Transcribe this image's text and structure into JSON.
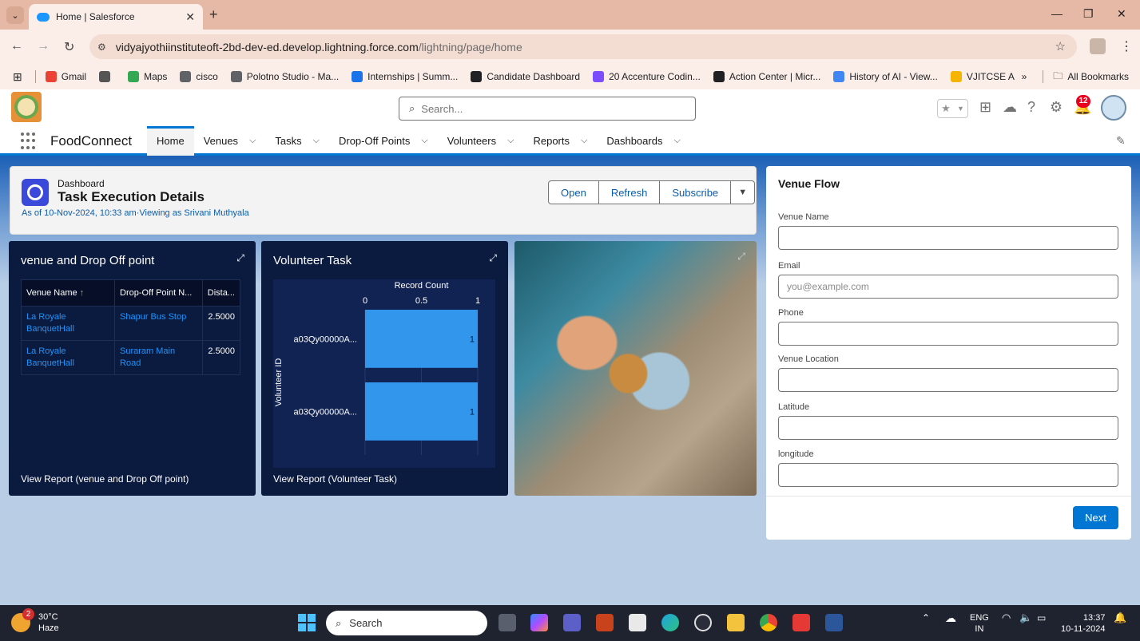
{
  "browser": {
    "tab_title": "Home | Salesforce",
    "url_main": "vidyajyothiinstituteoft-2bd-dev-ed.develop.lightning.force.com",
    "url_path": "/lightning/page/home",
    "bookmarks": [
      {
        "label": "Gmail",
        "icon": "gmail-icon",
        "color": "#ea4335"
      },
      {
        "label": "",
        "icon": "puzzle-icon",
        "color": "#555555"
      },
      {
        "label": "Maps",
        "icon": "maps-icon",
        "color": "#34a853"
      },
      {
        "label": "cisco",
        "icon": "cisco-icon",
        "color": "#5f6368"
      },
      {
        "label": "Polotno Studio - Ma...",
        "icon": "polotno-icon",
        "color": "#5f6368"
      },
      {
        "label": "Internships | Summ...",
        "icon": "internshala-icon",
        "color": "#1a73e8"
      },
      {
        "label": "Candidate Dashboard",
        "icon": "e-icon",
        "color": "#202124"
      },
      {
        "label": "20 Accenture Codin...",
        "icon": "c-icon",
        "color": "#7c4dff"
      },
      {
        "label": "Action Center | Micr...",
        "icon": "github-icon",
        "color": "#202124"
      },
      {
        "label": "History of AI - View...",
        "icon": "history-icon",
        "color": "#4285f4"
      },
      {
        "label": "VJITCSE A",
        "icon": "classroom-icon",
        "color": "#f4b400"
      }
    ],
    "all_bookmarks": "All Bookmarks"
  },
  "sf": {
    "search_placeholder": "Search...",
    "notification_count": "12",
    "app_name": "FoodConnect",
    "nav": [
      {
        "label": "Home",
        "active": true
      },
      {
        "label": "Venues"
      },
      {
        "label": "Tasks"
      },
      {
        "label": "Drop-Off Points"
      },
      {
        "label": "Volunteers"
      },
      {
        "label": "Reports"
      },
      {
        "label": "Dashboards"
      }
    ]
  },
  "dashboard": {
    "type_label": "Dashboard",
    "title": "Task Execution Details",
    "subtitle": "As of 10-Nov-2024, 10:33 am·Viewing as Srivani Muthyala",
    "buttons": {
      "open": "Open",
      "refresh": "Refresh",
      "subscribe": "Subscribe"
    }
  },
  "venue_panel": {
    "title": "venue and Drop Off point",
    "columns": [
      "Venue Name",
      "Drop-Off Point N...",
      "Dista..."
    ],
    "sort_indicator": "↑",
    "rows": [
      {
        "venue": "La Royale BanquetHall",
        "dropoff": "Shapur Bus Stop",
        "distance": "2.5000"
      },
      {
        "venue": "La Royale BanquetHall",
        "dropoff": "Suraram Main Road",
        "distance": "2.5000"
      }
    ],
    "footer": "View Report (venue and Drop Off point)"
  },
  "volunteer_panel": {
    "title": "Volunteer Task",
    "footer": "View Report (Volunteer Task)"
  },
  "chart_data": {
    "type": "bar",
    "orientation": "horizontal",
    "categories": [
      "a03Qy00000A...",
      "a03Qy00000A..."
    ],
    "values": [
      1,
      1
    ],
    "title": "Record Count",
    "xlabel": "Record Count",
    "ylabel": "Volunteer ID",
    "xlim": [
      0,
      1
    ],
    "xticks": [
      "0",
      "0.5",
      "1"
    ],
    "bar_color": "#3296ed",
    "grid": true
  },
  "flow": {
    "title": "Venue Flow",
    "fields": [
      {
        "label": "Venue Name",
        "placeholder": "",
        "value": ""
      },
      {
        "label": "Email",
        "placeholder": "you@example.com",
        "value": ""
      },
      {
        "label": "Phone",
        "placeholder": "",
        "value": ""
      },
      {
        "label": "Venue Location",
        "placeholder": "",
        "value": ""
      },
      {
        "label": "Latitude",
        "placeholder": "",
        "value": ""
      },
      {
        "label": "longitude",
        "placeholder": "",
        "value": ""
      }
    ],
    "next_label": "Next"
  },
  "taskbar": {
    "weather_temp": "30°C",
    "weather_desc": "Haze",
    "weather_badge": "2",
    "search_placeholder": "Search",
    "lang_top": "ENG",
    "lang_bottom": "IN",
    "time": "13:37",
    "date": "10-11-2024"
  }
}
